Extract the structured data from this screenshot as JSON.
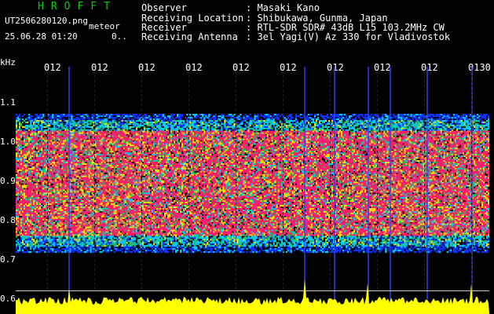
{
  "app": {
    "title": "HROFFT",
    "filename": "UT2506280120.png",
    "mode": "meteor",
    "datetime": "25.06.28 01:20",
    "counter": "0.."
  },
  "station": {
    "observer_label": "Observer",
    "observer_value": ": Masaki Kano",
    "location_label": "Receiving Location",
    "location_value": ": Shibukawa, Gunma, Japan",
    "receiver_label": "Receiver",
    "receiver_value": ": RTL-SDR SDR# 43dB L15 103.2MHz CW",
    "antenna_label": "Receiving Antenna",
    "antenna_value": ": 3el Yagi(V) Az 330 for Vladivostok"
  },
  "axis": {
    "y_unit": "kHz",
    "y_ticks": [
      "1.1",
      "1.0",
      "0.9",
      "0.8",
      "0.7",
      "0.6"
    ],
    "x_ticks": [
      "012",
      "012",
      "012",
      "012",
      "012",
      "012",
      "012",
      "012",
      "012",
      "0130"
    ]
  },
  "colors": {
    "noise_strong": "#ff1f6e",
    "noise_mid": "#ffe000",
    "noise_low": "#00d0ff",
    "noise_faint": "#1030ff",
    "spectrum_line": "#ffff00",
    "title_green": "#00d000"
  }
}
